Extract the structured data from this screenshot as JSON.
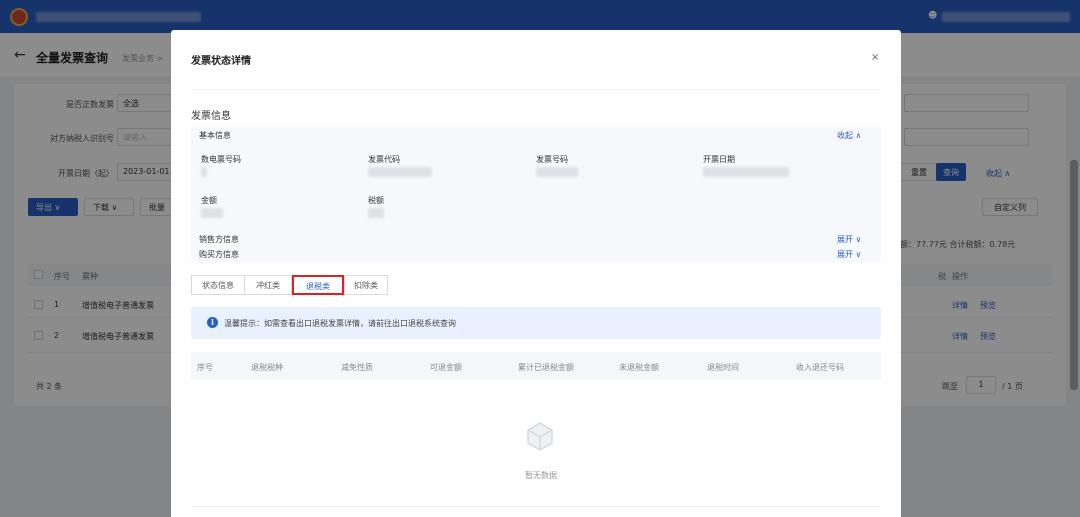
{
  "page": {
    "title": "全量发票查询",
    "breadcrumb": "发票业务 >"
  },
  "filters": {
    "is_formal_label": "是否正数发票",
    "is_formal_value": "全选",
    "buyer_id_label": "对方纳税人识别号",
    "buyer_id_placeholder": "请输入",
    "date_start_label": "开票日期（起）",
    "date_start_value": "2023-01-01"
  },
  "toolbar": {
    "export_label": "导出 ∨",
    "download_label": "下载 ∨",
    "batch_label": "批量",
    "reset_label": "重置",
    "query_label": "查询",
    "collapse_label": "收起 ∧",
    "custom_columns_label": "自定义列"
  },
  "table": {
    "headers": [
      "序号",
      "票种",
      "税",
      "操作"
    ],
    "summary": "额：77.77元  合计税额：0.78元",
    "rows": [
      {
        "index": "1",
        "type": "增值税电子普通发票",
        "actions": [
          "详情",
          "预览"
        ]
      },
      {
        "index": "2",
        "type": "增值税电子普通发票",
        "actions": [
          "详情",
          "预览"
        ]
      }
    ],
    "total": "共 2 条"
  },
  "pagination": {
    "goto_label": "跳至",
    "page_value": "1",
    "total_pages": "/ 1 页"
  },
  "modal": {
    "title": "发票状态详情",
    "close": "×",
    "section_title": "发票信息",
    "basic_info": {
      "label": "基本信息",
      "toggle": "收起 ∧",
      "fields": [
        "数电票号码",
        "发票代码",
        "发票号码",
        "开票日期",
        "金额",
        "税额"
      ]
    },
    "seller_info": {
      "label": "销售方信息",
      "toggle": "展开 ∨"
    },
    "buyer_info": {
      "label": "购买方信息",
      "toggle": "展开 ∨"
    },
    "tabs": [
      "状态信息",
      "冲红类",
      "退税类",
      "扣除类"
    ],
    "active_tab": "退税类",
    "tip": "温馨提示：如需查看出口退税发票详情，请前往出口退税系统查询",
    "refund_table": {
      "headers": [
        "序号",
        "退税税种",
        "减免性质",
        "可退金额",
        "累计已退税金额",
        "未退税金额",
        "退税时间",
        "收入退还号码"
      ]
    },
    "empty_text": "暂无数据"
  },
  "colors": {
    "brand": "#2a5ec4",
    "highlight": "#e0201f"
  }
}
